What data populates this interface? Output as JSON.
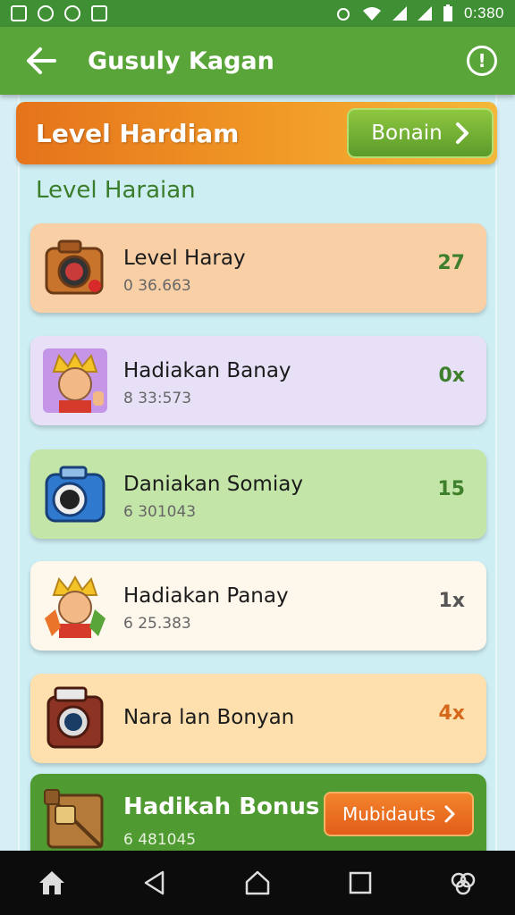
{
  "status_bar": {
    "time": "0:380",
    "icons": [
      "image-icon",
      "settings-icon",
      "record-icon",
      "gallery-icon",
      "alarm-icon",
      "wifi-icon",
      "signal-icon",
      "battery-icon"
    ]
  },
  "app_bar": {
    "title": "Gusuly Kagan",
    "back_icon": "arrow-left-icon",
    "info_icon": "info-circle-icon",
    "info_glyph": "!"
  },
  "banner": {
    "title": "Level Hardiam",
    "button_label": "Bonain",
    "button_icon": "chevron-right-icon"
  },
  "section": {
    "title": "Level Haraian"
  },
  "items": [
    {
      "name": "Level Haray",
      "sub": "0 36.663",
      "value": "27",
      "icon": "camera-orange-icon",
      "bg": "#f9cfa6",
      "value_color": "#3d7f2a"
    },
    {
      "name": "Hadiakan Banay",
      "sub": "8 33:573",
      "value": "0x",
      "icon": "king-character-icon",
      "bg": "#e8e0f7",
      "value_color": "#3d7f2a"
    },
    {
      "name": "Daniakan Somiay",
      "sub": "6 301043",
      "value": "15",
      "icon": "camera-blue-icon",
      "bg": "#c3e5a8",
      "value_color": "#3d7f2a"
    },
    {
      "name": "Hadiakan Panay",
      "sub": "6 25.383",
      "value": "1x",
      "icon": "king-character-icon",
      "bg": "#fdf7ec",
      "value_color": "#555555"
    },
    {
      "name": "Nara lan Bonyan",
      "sub": "",
      "value": "4x",
      "icon": "camera-red-icon",
      "bg": "#fde0ad",
      "value_color": "#d5681a"
    }
  ],
  "bonus": {
    "name": "Hadikah Bonus",
    "sub": "6 481045",
    "button_label": "Mubidauts",
    "button_icon": "chevron-right-icon",
    "icon": "treasure-crate-icon",
    "bg": "#4f9a31"
  },
  "nav": {
    "icons": [
      "home-icon",
      "back-triangle-icon",
      "home-circle-icon",
      "recents-square-icon",
      "assistant-icon"
    ]
  }
}
